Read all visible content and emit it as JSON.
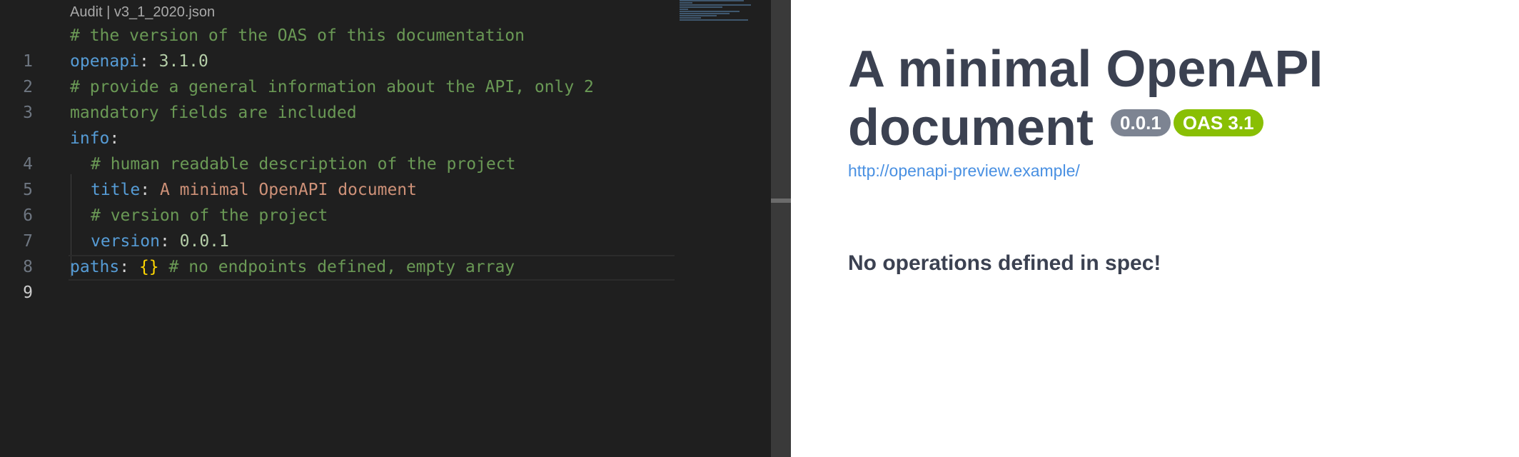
{
  "editor": {
    "breadcrumb": "Audit | v3_1_2020.json",
    "lines": [
      {
        "number": "1",
        "comment": "# the version of the OAS of this documentation"
      },
      {
        "number": "2",
        "key": "openapi",
        "colon": ": ",
        "value": "3.1.0"
      },
      {
        "number": "3",
        "comment": "# provide a general information about the API, only 2"
      },
      {
        "number": "",
        "comment": "mandatory fields are included"
      },
      {
        "number": "4",
        "key": "info",
        "colon": ":"
      },
      {
        "number": "5",
        "comment": "# human readable description of the project"
      },
      {
        "number": "6",
        "key": "title",
        "colon": ": ",
        "value": "A minimal OpenAPI document"
      },
      {
        "number": "7",
        "comment": "# version of the project"
      },
      {
        "number": "8",
        "key": "version",
        "colon": ": ",
        "value": "0.0.1"
      },
      {
        "number": "9",
        "key": "paths",
        "colon": ": ",
        "brace": "{}",
        "comment": " # no endpoints defined, empty array"
      }
    ]
  },
  "preview": {
    "title": "A minimal OpenAPI document",
    "version_badge": "0.0.1",
    "oas_badge": "OAS 3.1",
    "base_url": "http://openapi-preview.example/",
    "empty_message": "No operations defined in spec!"
  },
  "colors": {
    "editor_bg": "#1f1f1f",
    "comment": "#6a9955",
    "key": "#569cd6",
    "number": "#b5cea8",
    "string": "#ce9178",
    "version_badge_bg": "#7d8492",
    "oas_badge_bg": "#89bf04",
    "link": "#4990e2",
    "heading": "#3b4151"
  }
}
